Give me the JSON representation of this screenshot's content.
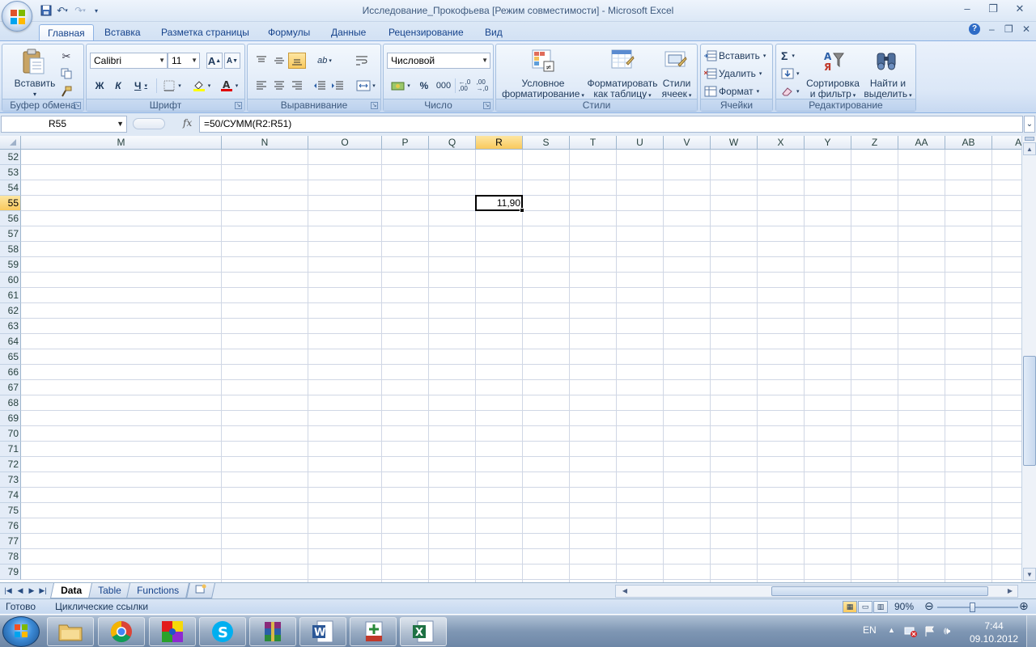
{
  "window": {
    "title": "Исследование_Прокофьева  [Режим совместимости] - Microsoft Excel",
    "controls": [
      "–",
      "❐",
      "✕"
    ]
  },
  "ribbon_tabs": [
    {
      "label": "Главная",
      "active": true
    },
    {
      "label": "Вставка"
    },
    {
      "label": "Разметка страницы"
    },
    {
      "label": "Формулы"
    },
    {
      "label": "Данные"
    },
    {
      "label": "Рецензирование"
    },
    {
      "label": "Вид"
    }
  ],
  "ribbon_right_controls": [
    "?",
    "–",
    "❐",
    "✕"
  ],
  "ribbon": {
    "clipboard": {
      "label": "Буфер обмена",
      "paste_label": "Вставить"
    },
    "font": {
      "label": "Шрифт",
      "font_name": "Calibri",
      "font_size": "11",
      "bold": "Ж",
      "italic": "К",
      "underline": "Ч",
      "grow": "A",
      "shrink": "A"
    },
    "alignment": {
      "label": "Выравнивание"
    },
    "number": {
      "label": "Число",
      "format": "Числовой",
      "percent": "%",
      "thousands": "000"
    },
    "styles": {
      "label": "Стили",
      "conditional": [
        "Условное",
        "форматирование"
      ],
      "as_table": [
        "Форматировать",
        "как таблицу"
      ],
      "cell_styles": [
        "Стили",
        "ячеек"
      ]
    },
    "cells": {
      "label": "Ячейки",
      "insert": "Вставить",
      "delete": "Удалить",
      "format": "Формат"
    },
    "editing": {
      "label": "Редактирование",
      "sigma": "Σ",
      "sort": [
        "Сортировка",
        "и фильтр"
      ],
      "find": [
        "Найти и",
        "выделить"
      ]
    }
  },
  "formula_bar": {
    "name_box": "R55",
    "fx_label": "fx",
    "formula": "=50/СУММ(R2:R51)"
  },
  "sheet": {
    "columns": [
      "M",
      "N",
      "O",
      "P",
      "Q",
      "R",
      "S",
      "T",
      "U",
      "V",
      "W",
      "X",
      "Y",
      "Z",
      "AA",
      "AB",
      "AC"
    ],
    "rows": [
      "52",
      "53",
      "54",
      "55",
      "56",
      "57",
      "58",
      "59",
      "60",
      "61",
      "62",
      "63",
      "64",
      "65",
      "66",
      "67",
      "68",
      "69",
      "70",
      "71",
      "72",
      "73",
      "74",
      "75",
      "76",
      "77",
      "78",
      "79"
    ],
    "selected_column": "R",
    "selected_row": "55",
    "cells": [
      {
        "ref": "R55",
        "col": "R",
        "row": "55",
        "value": "11,90"
      }
    ]
  },
  "sheet_tabs": [
    {
      "label": "Data",
      "active": true
    },
    {
      "label": "Table"
    },
    {
      "label": "Functions"
    }
  ],
  "status": {
    "ready": "Готово",
    "circular": "Циклические ссылки",
    "zoom": "90%",
    "zoom_level_percent": 90
  },
  "taskbar": {
    "apps": [
      "explorer",
      "chrome",
      "paint-app",
      "skype",
      "winrar",
      "word",
      "spss",
      "excel"
    ],
    "lang": "EN",
    "time": "7:44",
    "date": "09.10.2012"
  },
  "colors": {
    "accent": "#15428b",
    "selection": "#f9c95d",
    "grid": "#d0d7e5"
  }
}
